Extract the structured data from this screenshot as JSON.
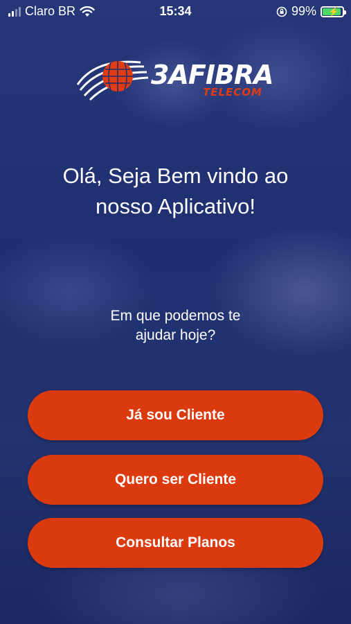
{
  "status_bar": {
    "carrier": "Claro BR",
    "time": "15:34",
    "battery_percent": "99%",
    "battery_level": 0.99
  },
  "logo": {
    "brand_main": "3AFIBRA",
    "brand_sub": "TELECOM"
  },
  "welcome": {
    "line1": "Olá, Seja Bem vindo ao",
    "line2": "nosso Aplicativo!"
  },
  "question": {
    "line1": "Em que podemos te",
    "line2": "ajudar hoje?"
  },
  "buttons": {
    "existing_client": "Já sou Cliente",
    "new_client": "Quero ser Cliente",
    "plans": "Consultar Planos"
  },
  "colors": {
    "accent": "#db3a0e",
    "background": "#1f2d6a"
  }
}
